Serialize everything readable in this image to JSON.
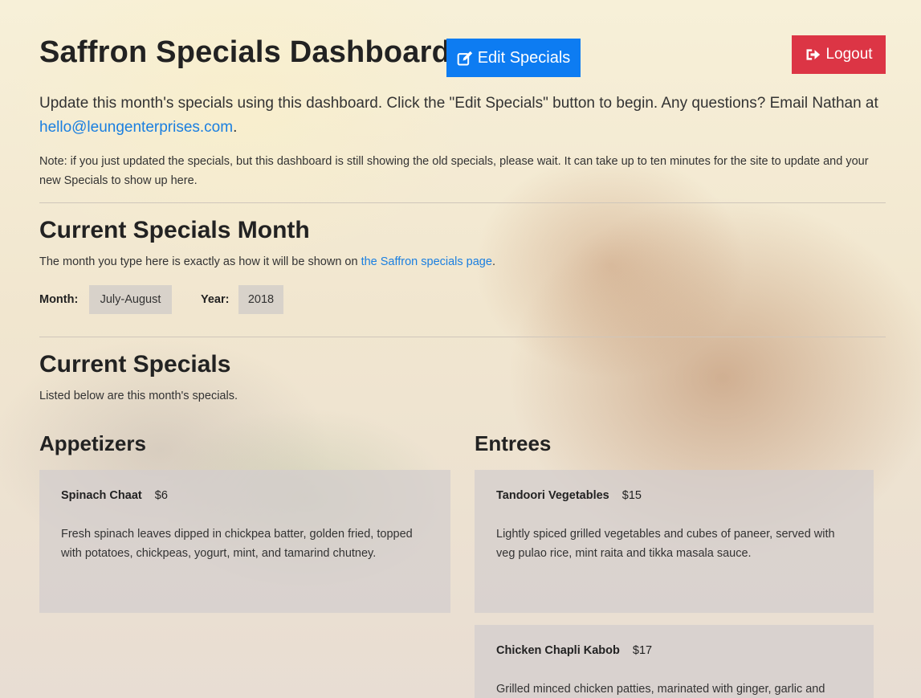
{
  "header": {
    "title": "Saffron Specials Dashboard",
    "edit_label": "Edit Specials",
    "logout_label": "Logout"
  },
  "intro": {
    "text": "Update this month's specials using this dashboard. Click the \"Edit Specials\" button to begin. Any questions? Email Nathan at ",
    "email": "hello@leungenterprises.com",
    "end": "."
  },
  "note": "Note: if you just updated the specials, but this dashboard is still showing the old specials, please wait. It can take up to ten minutes for the site to update and your new Specials to show up here.",
  "month_section": {
    "title": "Current Specials Month",
    "desc_prefix": "The month you type here is exactly as how it will be shown on ",
    "link_text": "the Saffron specials page",
    "desc_suffix": ".",
    "month_label": "Month:",
    "month_value": "July-August",
    "year_label": "Year:",
    "year_value": "2018"
  },
  "specials": {
    "title": "Current Specials",
    "desc": "Listed below are this month's specials.",
    "appetizers_title": "Appetizers",
    "entrees_title": "Entrees",
    "appetizers": [
      {
        "name": "Spinach Chaat",
        "price": "$6",
        "desc": "Fresh spinach leaves dipped in chickpea batter, golden fried, topped with potatoes, chickpeas, yogurt, mint, and tamarind chutney."
      }
    ],
    "entrees": [
      {
        "name": "Tandoori Vegetables",
        "price": "$15",
        "desc": "Lightly spiced grilled vegetables and cubes of paneer, served with veg pulao rice, mint raita and tikka masala sauce."
      },
      {
        "name": "Chicken Chapli Kabob",
        "price": "$17",
        "desc": "Grilled minced chicken patties, marinated with ginger, garlic and"
      }
    ]
  },
  "colors": {
    "primary": "#0d7cf2",
    "danger": "#dc3545",
    "link": "#1a7fe0"
  }
}
